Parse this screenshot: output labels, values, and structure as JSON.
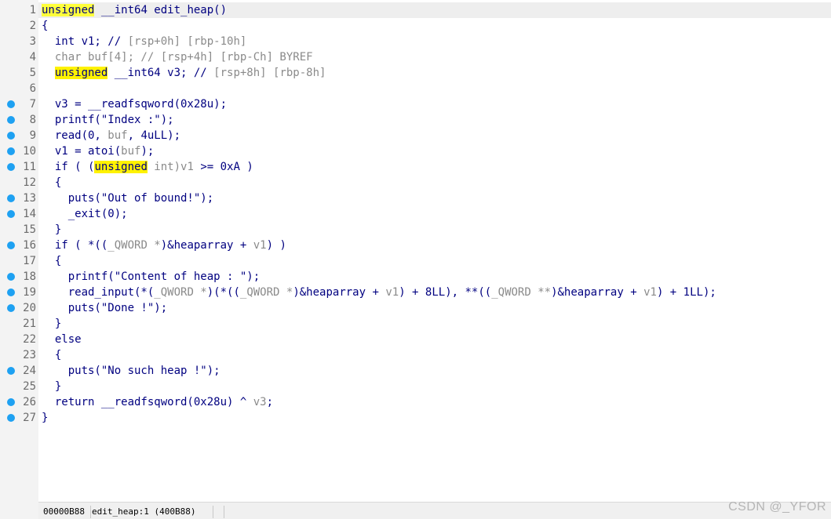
{
  "colors": {
    "keyword": "#000080",
    "gray_var": "#8a8a8a",
    "highlight": "#fff200",
    "breakpoint": "#1ea1f2",
    "gutter_bg": "#f3f3f3",
    "current_line_bg": "#eeeeee"
  },
  "icons": {
    "breakpoint": "breakpoint-dot-icon"
  },
  "code_lines": [
    {
      "num": "1",
      "bp": false,
      "tokens": [
        {
          "t": "unsigned",
          "c": "hlk"
        },
        {
          "t": " __int64 edit_heap()",
          "c": "kw"
        }
      ]
    },
    {
      "num": "2",
      "bp": false,
      "tokens": [
        {
          "t": "{",
          "c": "kw"
        }
      ]
    },
    {
      "num": "3",
      "bp": false,
      "tokens": [
        {
          "t": "  int v1; // ",
          "c": "kw"
        },
        {
          "t": "[rsp+0h] [rbp-10h]",
          "c": "gray"
        }
      ]
    },
    {
      "num": "4",
      "bp": false,
      "tokens": [
        {
          "t": "  char buf[4]; // [rsp+4h] [rbp-Ch] BYREF",
          "c": "gray"
        }
      ]
    },
    {
      "num": "5",
      "bp": false,
      "tokens": [
        {
          "t": "  ",
          "c": "kw"
        },
        {
          "t": "unsigned",
          "c": "hl"
        },
        {
          "t": " __int64 v3; // ",
          "c": "kw"
        },
        {
          "t": "[rsp+8h] [rbp-8h]",
          "c": "gray"
        }
      ]
    },
    {
      "num": "6",
      "bp": false,
      "tokens": [
        {
          "t": "",
          "c": "kw"
        }
      ]
    },
    {
      "num": "7",
      "bp": true,
      "tokens": [
        {
          "t": "  v3 = __readfsqword(0x28u);",
          "c": "kw"
        }
      ]
    },
    {
      "num": "8",
      "bp": true,
      "tokens": [
        {
          "t": "  printf(\"Index :\");",
          "c": "kw"
        }
      ]
    },
    {
      "num": "9",
      "bp": true,
      "tokens": [
        {
          "t": "  read(0, ",
          "c": "kw"
        },
        {
          "t": "buf",
          "c": "gray"
        },
        {
          "t": ", 4uLL);",
          "c": "kw"
        }
      ]
    },
    {
      "num": "10",
      "bp": true,
      "tokens": [
        {
          "t": "  v1 = atoi(",
          "c": "kw"
        },
        {
          "t": "buf",
          "c": "gray"
        },
        {
          "t": ");",
          "c": "kw"
        }
      ]
    },
    {
      "num": "11",
      "bp": true,
      "tokens": [
        {
          "t": "  if ( (",
          "c": "kw"
        },
        {
          "t": "unsigned",
          "c": "hl"
        },
        {
          "t": " int)",
          "c": "gray"
        },
        {
          "t": "v1",
          "c": "gray"
        },
        {
          "t": " >= 0xA )",
          "c": "kw"
        }
      ]
    },
    {
      "num": "12",
      "bp": false,
      "tokens": [
        {
          "t": "  {",
          "c": "kw"
        }
      ]
    },
    {
      "num": "13",
      "bp": true,
      "tokens": [
        {
          "t": "    puts(\"Out of bound!\");",
          "c": "kw"
        }
      ]
    },
    {
      "num": "14",
      "bp": true,
      "tokens": [
        {
          "t": "    _exit(0);",
          "c": "kw"
        }
      ]
    },
    {
      "num": "15",
      "bp": false,
      "tokens": [
        {
          "t": "  }",
          "c": "kw"
        }
      ]
    },
    {
      "num": "16",
      "bp": true,
      "tokens": [
        {
          "t": "  if ( *((",
          "c": "kw"
        },
        {
          "t": "_QWORD *",
          "c": "gray"
        },
        {
          "t": ")&heaparray + ",
          "c": "kw"
        },
        {
          "t": "v1",
          "c": "gray"
        },
        {
          "t": ") )",
          "c": "kw"
        }
      ]
    },
    {
      "num": "17",
      "bp": false,
      "tokens": [
        {
          "t": "  {",
          "c": "kw"
        }
      ]
    },
    {
      "num": "18",
      "bp": true,
      "tokens": [
        {
          "t": "    printf(\"Content of heap : \");",
          "c": "kw"
        }
      ]
    },
    {
      "num": "19",
      "bp": true,
      "tokens": [
        {
          "t": "    read_input(*(",
          "c": "kw"
        },
        {
          "t": "_QWORD *",
          "c": "gray"
        },
        {
          "t": ")(*((",
          "c": "kw"
        },
        {
          "t": "_QWORD *",
          "c": "gray"
        },
        {
          "t": ")&heaparray + ",
          "c": "kw"
        },
        {
          "t": "v1",
          "c": "gray"
        },
        {
          "t": ") + 8LL), **((",
          "c": "kw"
        },
        {
          "t": "_QWORD **",
          "c": "gray"
        },
        {
          "t": ")&heaparray + ",
          "c": "kw"
        },
        {
          "t": "v1",
          "c": "gray"
        },
        {
          "t": ") + 1LL);",
          "c": "kw"
        }
      ]
    },
    {
      "num": "20",
      "bp": true,
      "tokens": [
        {
          "t": "    puts(\"Done !\");",
          "c": "kw"
        }
      ]
    },
    {
      "num": "21",
      "bp": false,
      "tokens": [
        {
          "t": "  }",
          "c": "kw"
        }
      ]
    },
    {
      "num": "22",
      "bp": false,
      "tokens": [
        {
          "t": "  else",
          "c": "kw"
        }
      ]
    },
    {
      "num": "23",
      "bp": false,
      "tokens": [
        {
          "t": "  {",
          "c": "kw"
        }
      ]
    },
    {
      "num": "24",
      "bp": true,
      "tokens": [
        {
          "t": "    puts(\"No such heap !\");",
          "c": "kw"
        }
      ]
    },
    {
      "num": "25",
      "bp": false,
      "tokens": [
        {
          "t": "  }",
          "c": "kw"
        }
      ]
    },
    {
      "num": "26",
      "bp": true,
      "tokens": [
        {
          "t": "  return __readfsqword(0x28u) ^ ",
          "c": "kw"
        },
        {
          "t": "v3",
          "c": "gray"
        },
        {
          "t": ";",
          "c": "kw"
        }
      ]
    },
    {
      "num": "27",
      "bp": true,
      "tokens": [
        {
          "t": "}",
          "c": "kw"
        }
      ]
    }
  ],
  "statusbar": {
    "address": "00000B88",
    "location": "edit_heap:1 (400B88)",
    "extra": ""
  },
  "watermark": "CSDN @_YFOR"
}
